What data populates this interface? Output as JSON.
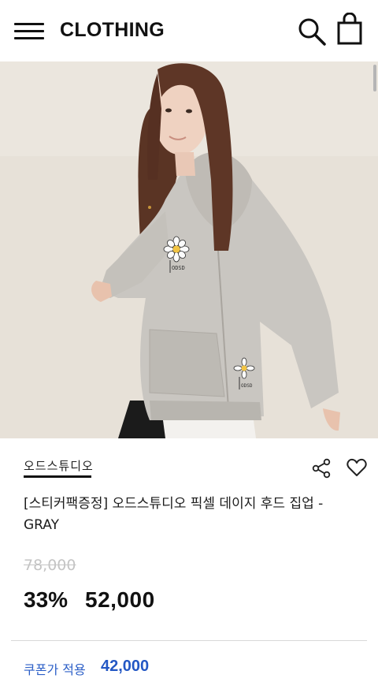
{
  "header": {
    "title": "CLOTHING",
    "menu_icon": "hamburger-menu-icon",
    "search_icon": "search-icon",
    "bag_icon": "shopping-bag-icon"
  },
  "product": {
    "brand": "오드스튜디오",
    "name": "[스티커팩증정] 오드스튜디오 픽셀 데이지 후드 집업 - GRAY",
    "original_price": "78,000",
    "discount_rate": "33%",
    "sale_price": "52,000",
    "coupon_label": "쿠폰가 적용",
    "coupon_price": "42,000",
    "hoodie_logo": "ODSD"
  },
  "colors": {
    "accent_blue": "#2357c4",
    "strike_gray": "#c4c4c4",
    "hoodie_gray": "#c9c6c1"
  }
}
